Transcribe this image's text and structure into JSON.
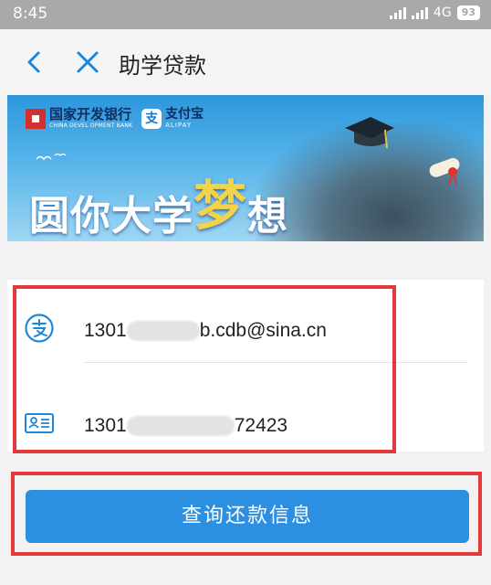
{
  "status_bar": {
    "time": "8:45",
    "network": "4G",
    "battery": "93"
  },
  "nav": {
    "title": "助学贷款",
    "back_icon": "chevron-left-icon",
    "close_icon": "close-icon"
  },
  "banner": {
    "bank_name": "国家开发银行",
    "bank_name_en": "CHINA DEVEL OPMENT BANK",
    "alipay_name": "支付宝",
    "alipay_en": "ALIPAY",
    "slogan_part1": "圆你大学",
    "slogan_accent": "梦",
    "slogan_part2": "想"
  },
  "form": {
    "account_icon": "alipay-icon",
    "account_prefix": "1301",
    "account_suffix": "b.cdb@sina.cn",
    "id_icon": "id-card-icon",
    "id_prefix": "1301",
    "id_suffix": "72423"
  },
  "actions": {
    "submit_label": "查询还款信息"
  },
  "colors": {
    "accent": "#2b8fe2",
    "highlight": "#e5383b",
    "status_bar": "#a9a9a9"
  }
}
